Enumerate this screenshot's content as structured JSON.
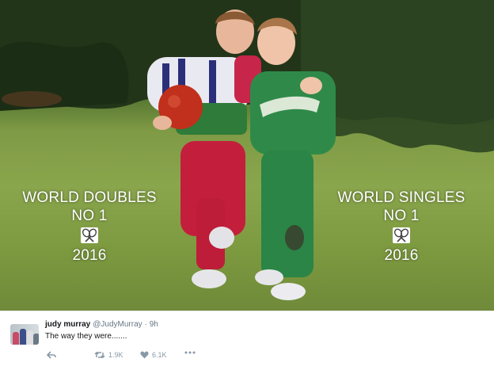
{
  "photo": {
    "left_caption": {
      "line1": "WORLD DOUBLES",
      "line2": "NO 1",
      "year": "2016"
    },
    "right_caption": {
      "line1": "WORLD SINGLES",
      "line2": "NO 1",
      "year": "2016"
    },
    "caption_icon": "crossed-tennis-rackets-icon"
  },
  "tweet": {
    "display_name": "judy murray",
    "handle": "@JudyMurray",
    "time": "· 9h",
    "text": "The way they were.......",
    "retweet_count": "1.9K",
    "like_count": "6.1K",
    "icons": [
      "reply-icon",
      "retweet-icon",
      "like-heart-icon",
      "more-options-icon"
    ]
  },
  "colors": {
    "grass": "#8aa64c",
    "tweet_text": "#14171a",
    "meta_gray": "#8899a6"
  }
}
